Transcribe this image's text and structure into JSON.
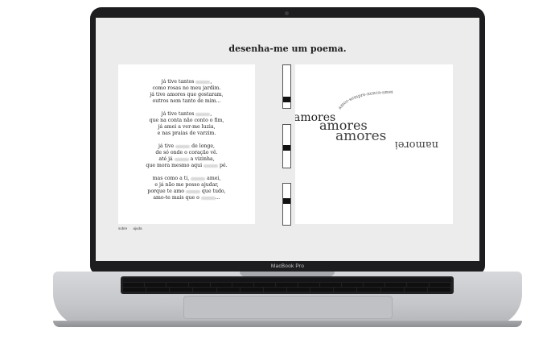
{
  "laptop": {
    "model_label": "MacBook Pro"
  },
  "app": {
    "title": "desenha-me um poema."
  },
  "poem": {
    "stanzas": [
      [
        {
          "pre": "já  tive tantos ",
          "blur": true,
          "post": ","
        },
        {
          "pre": "como rosas no meu jardim.",
          "blur": false,
          "post": ""
        },
        {
          "pre": "já  tive amores que gostaram,",
          "blur": false,
          "post": ""
        },
        {
          "pre": "outros  nem tanto de mim...",
          "blur": false,
          "post": ""
        }
      ],
      [
        {
          "pre": "já  tive tantos ",
          "blur": true,
          "post": ","
        },
        {
          "pre": "que  na conta não conto o fim,",
          "blur": false,
          "post": ""
        },
        {
          "pre": "já  amei a ver-me luzia,",
          "blur": false,
          "post": ""
        },
        {
          "pre": "e  nas praias de varzim.",
          "blur": false,
          "post": ""
        }
      ],
      [
        {
          "pre": "já  tive ",
          "blur": true,
          "post": " de longe,"
        },
        {
          "pre": "de  só onde o coração vê.",
          "blur": false,
          "post": ""
        },
        {
          "pre": "até  já ",
          "blur": true,
          "post": " a vizinha,"
        },
        {
          "pre": "que  mora mesmo aqui ",
          "blur": true,
          "post": " pé."
        }
      ],
      [
        {
          "pre": "mas como a ti, ",
          "blur": true,
          "post": " amei,"
        },
        {
          "pre": "e  já não me posso ajudar,",
          "blur": false,
          "post": ""
        },
        {
          "pre": "porque te amo ",
          "blur": true,
          "post": " que tudo,"
        },
        {
          "pre": "amo-te  mais que o ",
          "blur": true,
          "post": "..."
        }
      ]
    ]
  },
  "sliders": [
    {
      "name": "slider-1",
      "value": 0.85
    },
    {
      "name": "slider-2",
      "value": 0.55
    },
    {
      "name": "slider-3",
      "value": 0.4
    }
  ],
  "drawing": {
    "words": [
      "amores",
      "amores",
      "amores",
      "amores",
      "namorei"
    ],
    "arc_text": "amor-sempre-nunca-amei"
  },
  "footer": {
    "link1": "sobre",
    "link2": "ajuda"
  },
  "colors": {
    "screen_bg": "#ececec",
    "page_bg": "#ffffff",
    "text": "#222222",
    "bezel": "#1d1d1f"
  }
}
